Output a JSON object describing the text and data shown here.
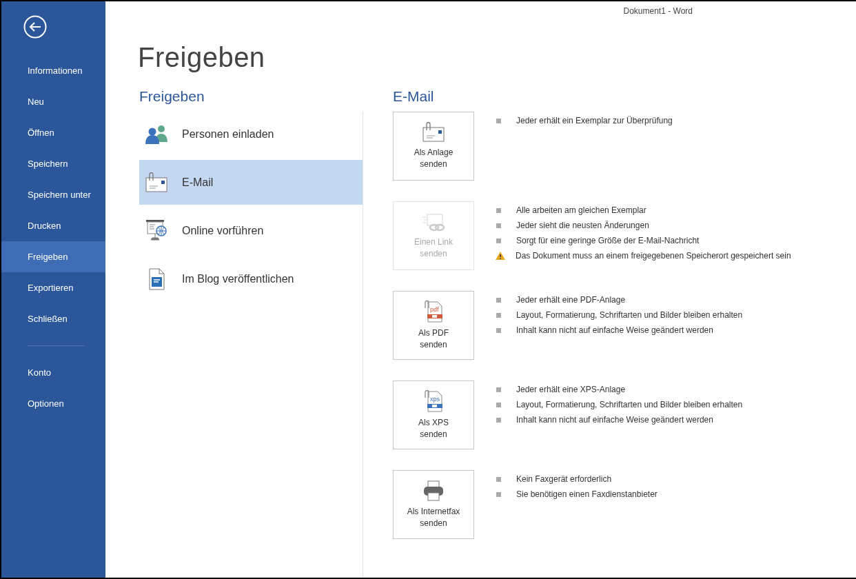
{
  "window": {
    "title": "Dokument1 - Word"
  },
  "sidebar": {
    "items": [
      {
        "label": "Informationen",
        "selected": false
      },
      {
        "label": "Neu",
        "selected": false
      },
      {
        "label": "Öffnen",
        "selected": false
      },
      {
        "label": "Speichern",
        "selected": false
      },
      {
        "label": "Speichern unter",
        "selected": false
      },
      {
        "label": "Drucken",
        "selected": false
      },
      {
        "label": "Freigeben",
        "selected": true
      },
      {
        "label": "Exportieren",
        "selected": false
      },
      {
        "label": "Schließen",
        "selected": false
      }
    ],
    "bottom_items": [
      {
        "label": "Konto",
        "selected": false
      },
      {
        "label": "Optionen",
        "selected": false
      }
    ]
  },
  "page_title": "Freigeben",
  "share": {
    "heading": "Freigeben",
    "items": [
      {
        "label": "Personen einladen",
        "selected": false
      },
      {
        "label": "E-Mail",
        "selected": true
      },
      {
        "label": "Online vorführen",
        "selected": false
      },
      {
        "label": "Im Blog veröffentlichen",
        "selected": false
      }
    ]
  },
  "email": {
    "heading": "E-Mail",
    "options": [
      {
        "button": [
          "Als Anlage",
          "senden"
        ],
        "disabled": false,
        "notes": [
          {
            "kind": "bullet",
            "text": "Jeder erhält ein Exemplar zur Überprüfung"
          }
        ]
      },
      {
        "button": [
          "Einen Link",
          "senden"
        ],
        "disabled": true,
        "notes": [
          {
            "kind": "bullet",
            "text": "Alle arbeiten am gleichen Exemplar"
          },
          {
            "kind": "bullet",
            "text": "Jeder sieht die neusten Änderungen"
          },
          {
            "kind": "bullet",
            "text": "Sorgt für eine geringe Größe der E-Mail-Nachricht"
          },
          {
            "kind": "warning",
            "text": "Das Dokument muss an einem freigegebenen Speicherort gespeichert sein"
          }
        ]
      },
      {
        "button": [
          "Als PDF",
          "senden"
        ],
        "icon_text": "pdf",
        "disabled": false,
        "notes": [
          {
            "kind": "bullet",
            "text": "Jeder erhält eine PDF-Anlage"
          },
          {
            "kind": "bullet",
            "text": "Layout, Formatierung, Schriftarten und Bilder bleiben erhalten"
          },
          {
            "kind": "bullet",
            "text": "Inhalt kann nicht auf einfache Weise geändert werden"
          }
        ]
      },
      {
        "button": [
          "Als XPS",
          "senden"
        ],
        "icon_text": "xps",
        "disabled": false,
        "notes": [
          {
            "kind": "bullet",
            "text": "Jeder erhält eine XPS-Anlage"
          },
          {
            "kind": "bullet",
            "text": "Layout, Formatierung, Schriftarten und Bilder bleiben erhalten"
          },
          {
            "kind": "bullet",
            "text": "Inhalt kann nicht auf einfache Weise geändert werden"
          }
        ]
      },
      {
        "button": [
          "Als Internetfax",
          "senden"
        ],
        "disabled": false,
        "notes": [
          {
            "kind": "bullet",
            "text": "Kein Faxgerät erforderlich"
          },
          {
            "kind": "bullet",
            "text": "Sie benötigen einen Faxdienstanbieter"
          }
        ]
      }
    ]
  }
}
